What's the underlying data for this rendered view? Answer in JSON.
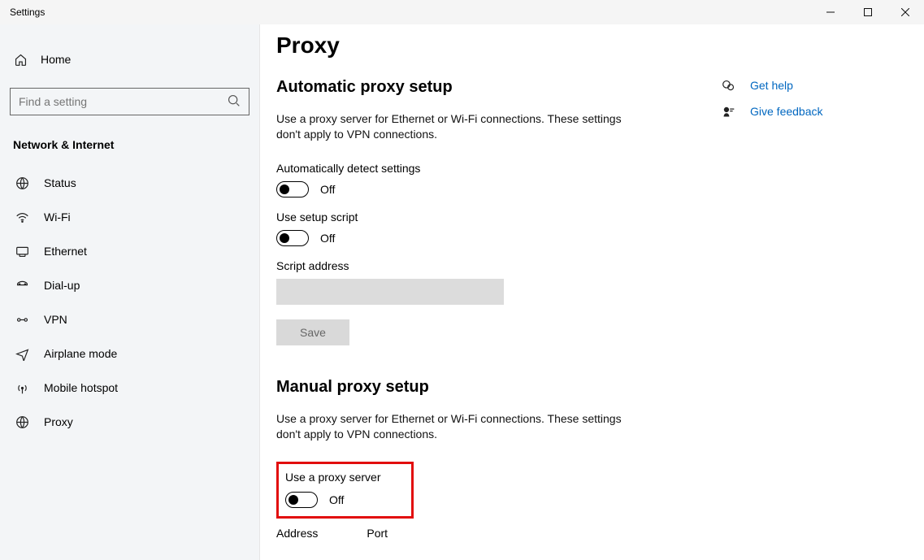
{
  "window": {
    "title": "Settings"
  },
  "sidebar": {
    "home": "Home",
    "search_placeholder": "Find a setting",
    "category": "Network & Internet",
    "items": [
      {
        "label": "Status"
      },
      {
        "label": "Wi-Fi"
      },
      {
        "label": "Ethernet"
      },
      {
        "label": "Dial-up"
      },
      {
        "label": "VPN"
      },
      {
        "label": "Airplane mode"
      },
      {
        "label": "Mobile hotspot"
      },
      {
        "label": "Proxy"
      }
    ]
  },
  "main": {
    "title": "Proxy",
    "section1": {
      "heading": "Automatic proxy setup",
      "desc": "Use a proxy server for Ethernet or Wi-Fi connections. These settings don't apply to VPN connections.",
      "auto_detect_label": "Automatically detect settings",
      "auto_detect_state": "Off",
      "use_script_label": "Use setup script",
      "use_script_state": "Off",
      "script_address_label": "Script address",
      "script_address_value": "",
      "save_label": "Save"
    },
    "section2": {
      "heading": "Manual proxy setup",
      "desc": "Use a proxy server for Ethernet or Wi-Fi connections. These settings don't apply to VPN connections.",
      "use_proxy_label": "Use a proxy server",
      "use_proxy_state": "Off",
      "address_label": "Address",
      "port_label": "Port"
    }
  },
  "aside": {
    "help": "Get help",
    "feedback": "Give feedback"
  }
}
